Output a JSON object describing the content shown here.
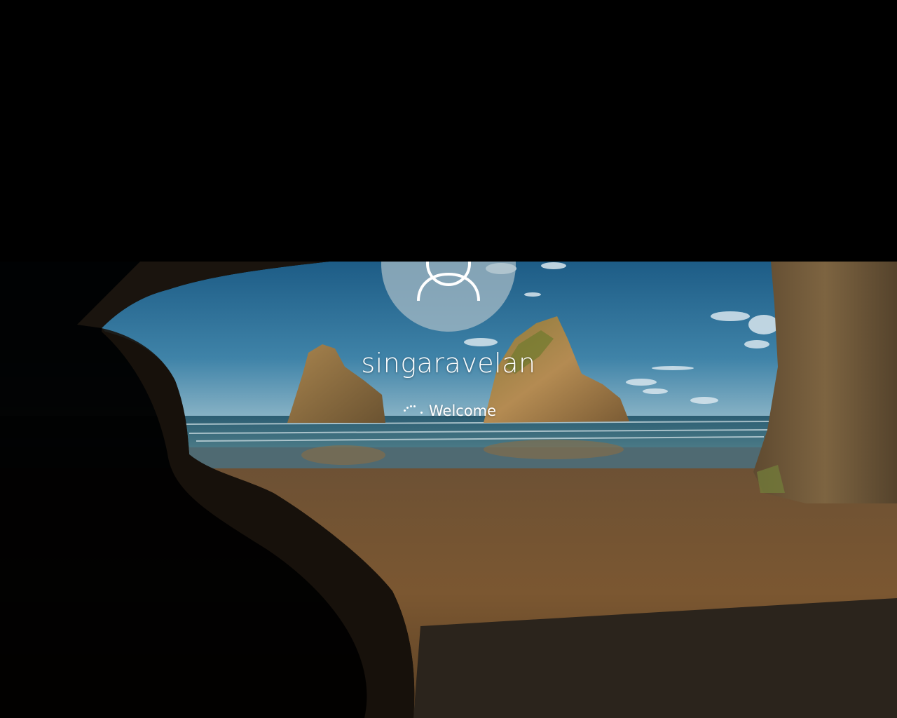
{
  "login": {
    "username": "singaravelan",
    "status_text": "Welcome",
    "avatar_icon": "user-silhouette-icon",
    "spinner_icon": "loading-spinner-icon"
  },
  "background": {
    "description_icon": "beach-cave-wallpaper"
  },
  "colors": {
    "text": "#ffffff",
    "avatar_fill": "#a8bcc8",
    "top_band": "#000000"
  }
}
